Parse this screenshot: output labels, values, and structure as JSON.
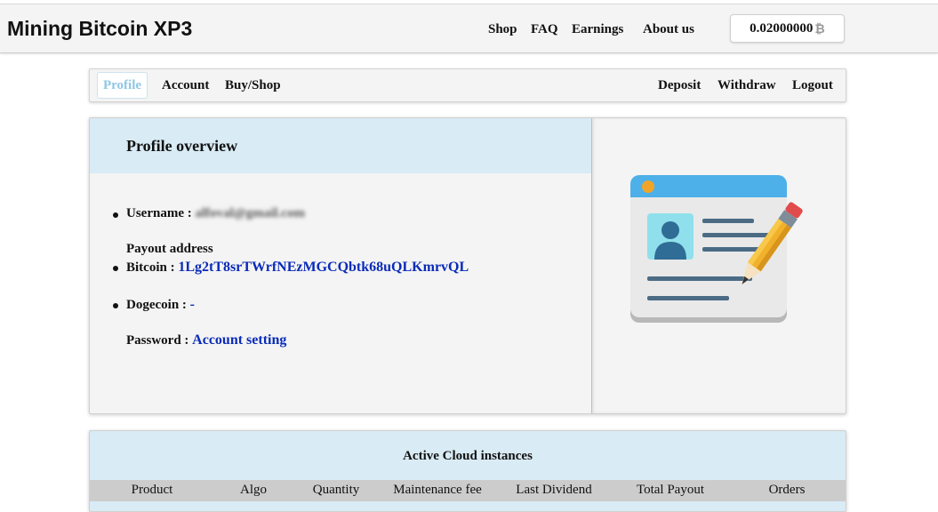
{
  "header": {
    "brand": "Mining Bitcoin XP3",
    "nav": [
      "Shop",
      "FAQ",
      "Earnings",
      "About us"
    ],
    "balance": "0.02000000",
    "balance_icon": "bitcoin-icon",
    "balance_symbol": "₿"
  },
  "subnav": {
    "left": [
      "Profile",
      "Account",
      "Buy/Shop"
    ],
    "active": "Profile",
    "right": [
      "Deposit",
      "Withdraw",
      "Logout"
    ]
  },
  "profile": {
    "title": "Profile overview",
    "username_label": "Username :",
    "username_value": "alfoval@gmail.com",
    "payout_label": "Payout address",
    "bitcoin_label": "Bitcoin :",
    "bitcoin_value": "1Lg2tT8srTWrfNEzMGCQbtk68uQLKmrvQL",
    "dogecoin_label": "Dogecoin :",
    "dogecoin_value": "-",
    "password_label": "Password :",
    "password_link": "Account setting",
    "illustration_icon": "profile-card-edit-icon"
  },
  "instances": {
    "title": "Active Cloud instances",
    "columns": [
      "Product",
      "Algo",
      "Quantity",
      "Maintenance fee",
      "Last Dividend",
      "Total Payout",
      "Orders"
    ]
  },
  "colors": {
    "panel_header": "#d9ebf5",
    "link": "#0a2bb8",
    "active_tab": "#8ec7e6"
  }
}
